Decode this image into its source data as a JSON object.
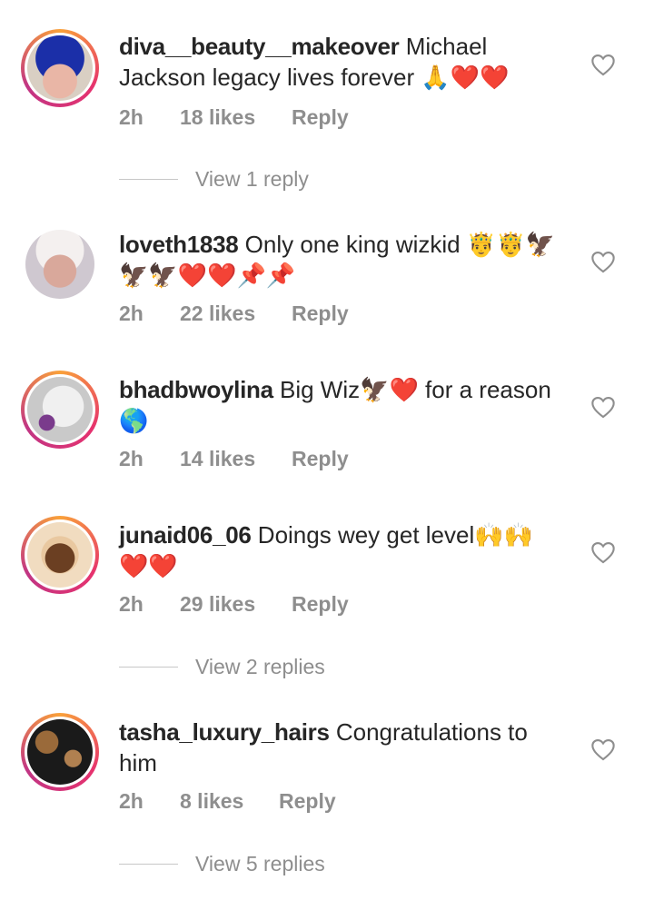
{
  "comments": [
    {
      "username": "diva__beauty__makeover",
      "text": " Michael Jackson legacy lives forever 🙏❤️❤️",
      "time": "2h",
      "likes": "18 likes",
      "reply": "Reply",
      "view_replies": "View 1 reply",
      "story_ring": true
    },
    {
      "username": "loveth1838",
      "text": " Only one king wizkid 🤴🤴🦅🦅🦅❤️❤️📌📌",
      "time": "2h",
      "likes": "22 likes",
      "reply": "Reply",
      "story_ring": false
    },
    {
      "username": "bhadbwoylina",
      "text": " Big Wiz🦅❤️ for a reason🌎",
      "time": "2h",
      "likes": "14 likes",
      "reply": "Reply",
      "story_ring": true
    },
    {
      "username": "junaid06_06",
      "text": " Doings wey get level🙌🙌❤️❤️",
      "time": "2h",
      "likes": "29 likes",
      "reply": "Reply",
      "view_replies": "View 2 replies",
      "story_ring": true
    },
    {
      "username": "tasha_luxury_hairs",
      "text": " Congratulations to him",
      "time": "2h",
      "likes": "8 likes",
      "reply": "Reply",
      "view_replies": "View 5 replies",
      "story_ring": true
    }
  ],
  "icons": {
    "like": "heart-outline-icon",
    "avatar": "user-avatar"
  },
  "colors": {
    "muted": "#8e8e8e",
    "text": "#262626",
    "story_ring": "#e6326e"
  }
}
